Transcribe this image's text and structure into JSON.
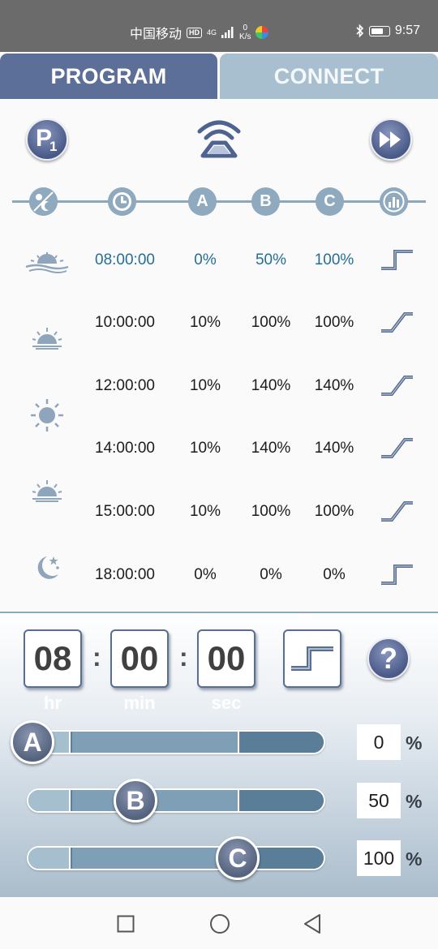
{
  "status_bar": {
    "carrier": "中国移动",
    "hd_badge": "HD",
    "signal_label": "4G",
    "net_speed_value": "0",
    "net_speed_unit": "K/s",
    "time": "9:57",
    "battery_level": 0.8
  },
  "tabs": [
    {
      "label": "PROGRAM",
      "active": true
    },
    {
      "label": "CONNECT",
      "active": false
    }
  ],
  "top_bar": {
    "program_letter": "P",
    "program_number": "1"
  },
  "timeline": {
    "nodes": [
      "day-night-icon",
      "clock-icon",
      "A",
      "B",
      "C",
      "intensity-icon"
    ]
  },
  "schedule": [
    {
      "time": "08:00:00",
      "a": "0%",
      "b": "50%",
      "c": "100%",
      "mode": "step",
      "active": true
    },
    {
      "time": "10:00:00",
      "a": "10%",
      "b": "100%",
      "c": "100%",
      "mode": "ramp",
      "active": false
    },
    {
      "time": "12:00:00",
      "a": "10%",
      "b": "140%",
      "c": "140%",
      "mode": "ramp",
      "active": false
    },
    {
      "time": "14:00:00",
      "a": "10%",
      "b": "140%",
      "c": "140%",
      "mode": "ramp",
      "active": false
    },
    {
      "time": "15:00:00",
      "a": "10%",
      "b": "100%",
      "c": "100%",
      "mode": "ramp",
      "active": false
    },
    {
      "time": "18:00:00",
      "a": "0%",
      "b": "0%",
      "c": "0%",
      "mode": "step",
      "active": false
    }
  ],
  "time_editor": {
    "hours": "08",
    "minutes": "00",
    "seconds": "00",
    "sep": ":",
    "hours_label": "hr",
    "minutes_label": "min",
    "seconds_label": "sec",
    "help_symbol": "?"
  },
  "channels": [
    {
      "name": "A",
      "value": "0",
      "unit": "%",
      "level": 0
    },
    {
      "name": "B",
      "value": "50",
      "unit": "%",
      "level": 50
    },
    {
      "name": "C",
      "value": "100",
      "unit": "%",
      "level": 100
    }
  ],
  "colors": {
    "active_tab": "#5c6f98",
    "inactive_tab": "#a7bfce",
    "active_row_text": "#256e98",
    "slider_track": "#5f7f9b"
  }
}
